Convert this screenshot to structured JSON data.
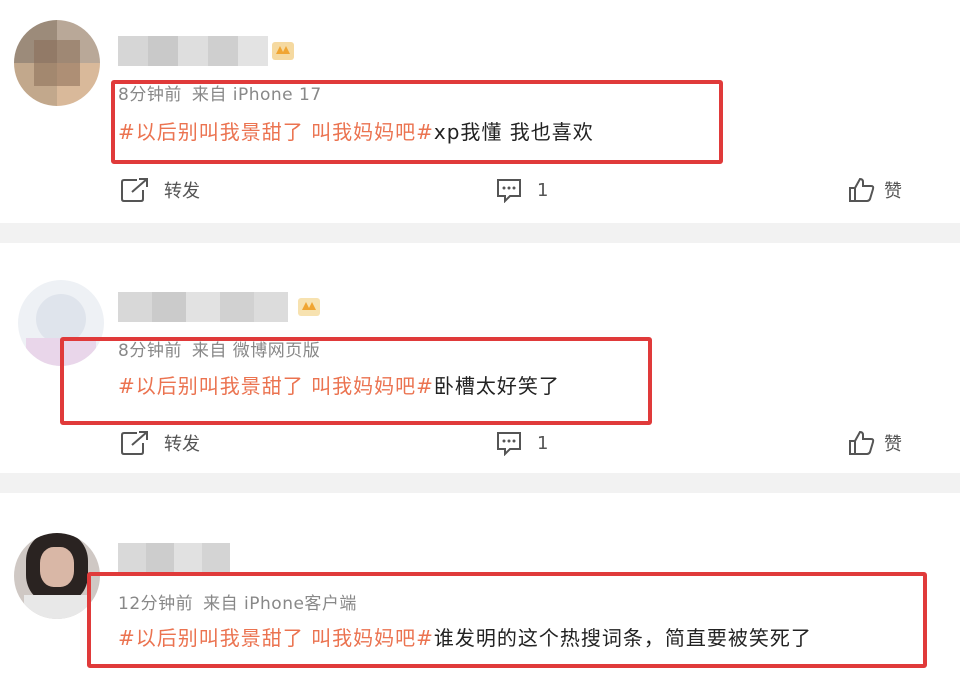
{
  "posts": [
    {
      "meta_time": "8分钟前",
      "meta_source": "来自 iPhone 17",
      "hashtag": "#以后别叫我景甜了 叫我妈妈吧#",
      "text": "xp我懂 我也喜欢",
      "repost_label": "转发",
      "comment_count": "1",
      "like_label": "赞"
    },
    {
      "meta_time": "8分钟前",
      "meta_source": "来自 微博网页版",
      "hashtag": "#以后别叫我景甜了 叫我妈妈吧#",
      "text": "卧槽太好笑了",
      "repost_label": "转发",
      "comment_count": "1",
      "like_label": "赞"
    },
    {
      "meta_time": "12分钟前",
      "meta_source": "来自 iPhone客户端",
      "hashtag": "#以后别叫我景甜了 叫我妈妈吧#",
      "text": "谁发明的这个热搜词条，简直要被笑死了"
    }
  ],
  "icons": {
    "repost": "repost-icon",
    "comment": "comment-icon",
    "like": "like-icon",
    "vip": "vip-badge-icon"
  },
  "colors": {
    "hashtag": "#eb7350",
    "highlight": "#e03a3a",
    "meta": "#888888"
  }
}
